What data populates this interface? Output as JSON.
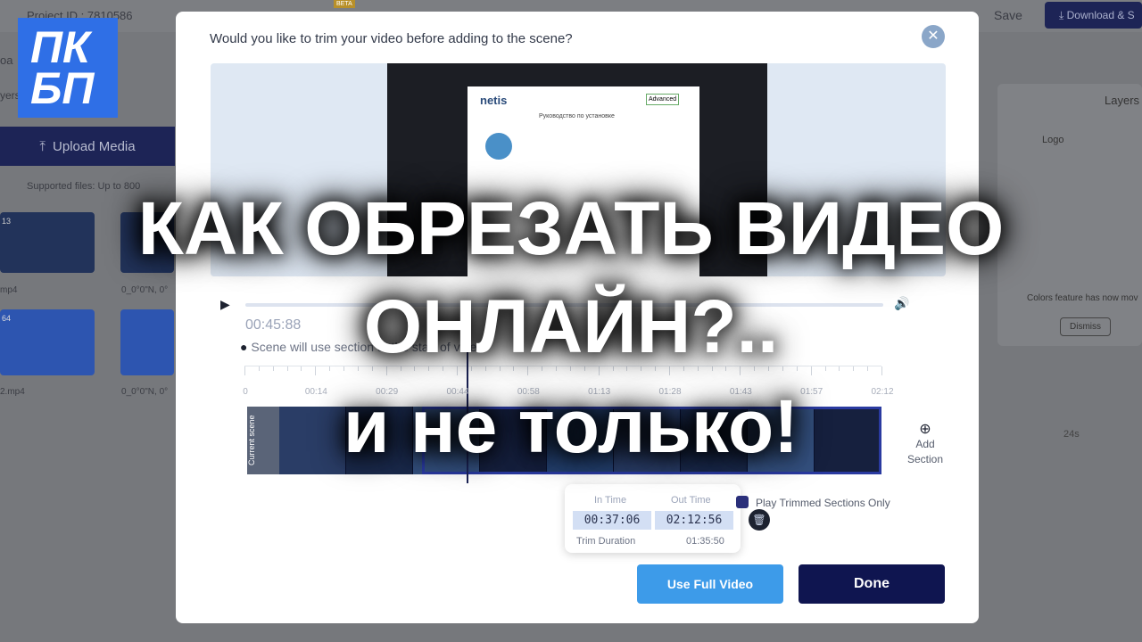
{
  "app": {
    "project_id": "Project ID : 7810586",
    "beta_badge": "BETA",
    "save_label": "Save",
    "download_label": "Download & S",
    "upload_label": "Upload Media",
    "supported_files": "Supported files: Up to 800",
    "file1": "mp4",
    "file2": "2.mp4",
    "coords1": "0_0°0\"N, 0°",
    "coords2": "0_0°0\"N, 0°",
    "thumb1_badge": "13",
    "thumb2_badge": "64",
    "layers_title": "Layers",
    "layer_logo": "Logo",
    "colors_notice": "Colors feature has now mov",
    "dismiss_label": "Dismiss",
    "timeline_mark": "24s"
  },
  "channel_logo": {
    "line1": "ПК",
    "line2": "БП"
  },
  "modal": {
    "title": "Would you like to trim your video before adding to the scene?",
    "close_icon": "close-icon",
    "preview_brand": "netis",
    "preview_heading": "Руководство по установке",
    "preview_button": "Advanced",
    "current_time": "00:45:88",
    "warning": "Scene will use section at the start of video",
    "ruler_labels": [
      "0",
      "00:14",
      "00:29",
      "00:44",
      "00:58",
      "01:13",
      "01:28",
      "01:43",
      "01:57",
      "02:12"
    ],
    "filmstrip_label": "Current scene",
    "add_section": "Add Section",
    "trim": {
      "in_label": "In Time",
      "out_label": "Out Time",
      "in_value": "00:37:06",
      "out_value": "02:12:56",
      "duration_label": "Trim Duration",
      "duration_value": "01:35:50"
    },
    "play_trimmed_label": "Play Trimmed Sections Only",
    "play_trimmed_checked": true,
    "use_full_label": "Use Full Video",
    "done_label": "Done",
    "colors": {
      "primary": "#0f1550",
      "accent": "#3d9be9"
    }
  },
  "overlay": {
    "line1": "КАК ОБРЕЗАТЬ ВИДЕО",
    "line2": "ОНЛАЙН?..",
    "line3": "и не только!"
  }
}
